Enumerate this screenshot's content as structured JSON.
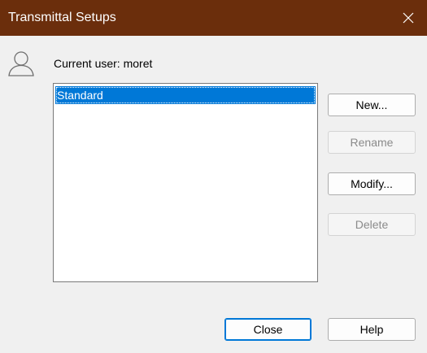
{
  "window": {
    "title": "Transmittal Setups",
    "close_glyph": "✕"
  },
  "user": {
    "icon": "user-icon",
    "label": "Current user: moret"
  },
  "setups": {
    "items": [
      {
        "label": "Standard",
        "selected": true
      }
    ]
  },
  "buttons": {
    "new": "New...",
    "rename": "Rename",
    "modify": "Modify...",
    "delete": "Delete",
    "close": "Close",
    "help": "Help"
  },
  "colors": {
    "titlebar": "#6b2e0c",
    "selection": "#0078d7",
    "background": "#f0f0f0"
  }
}
